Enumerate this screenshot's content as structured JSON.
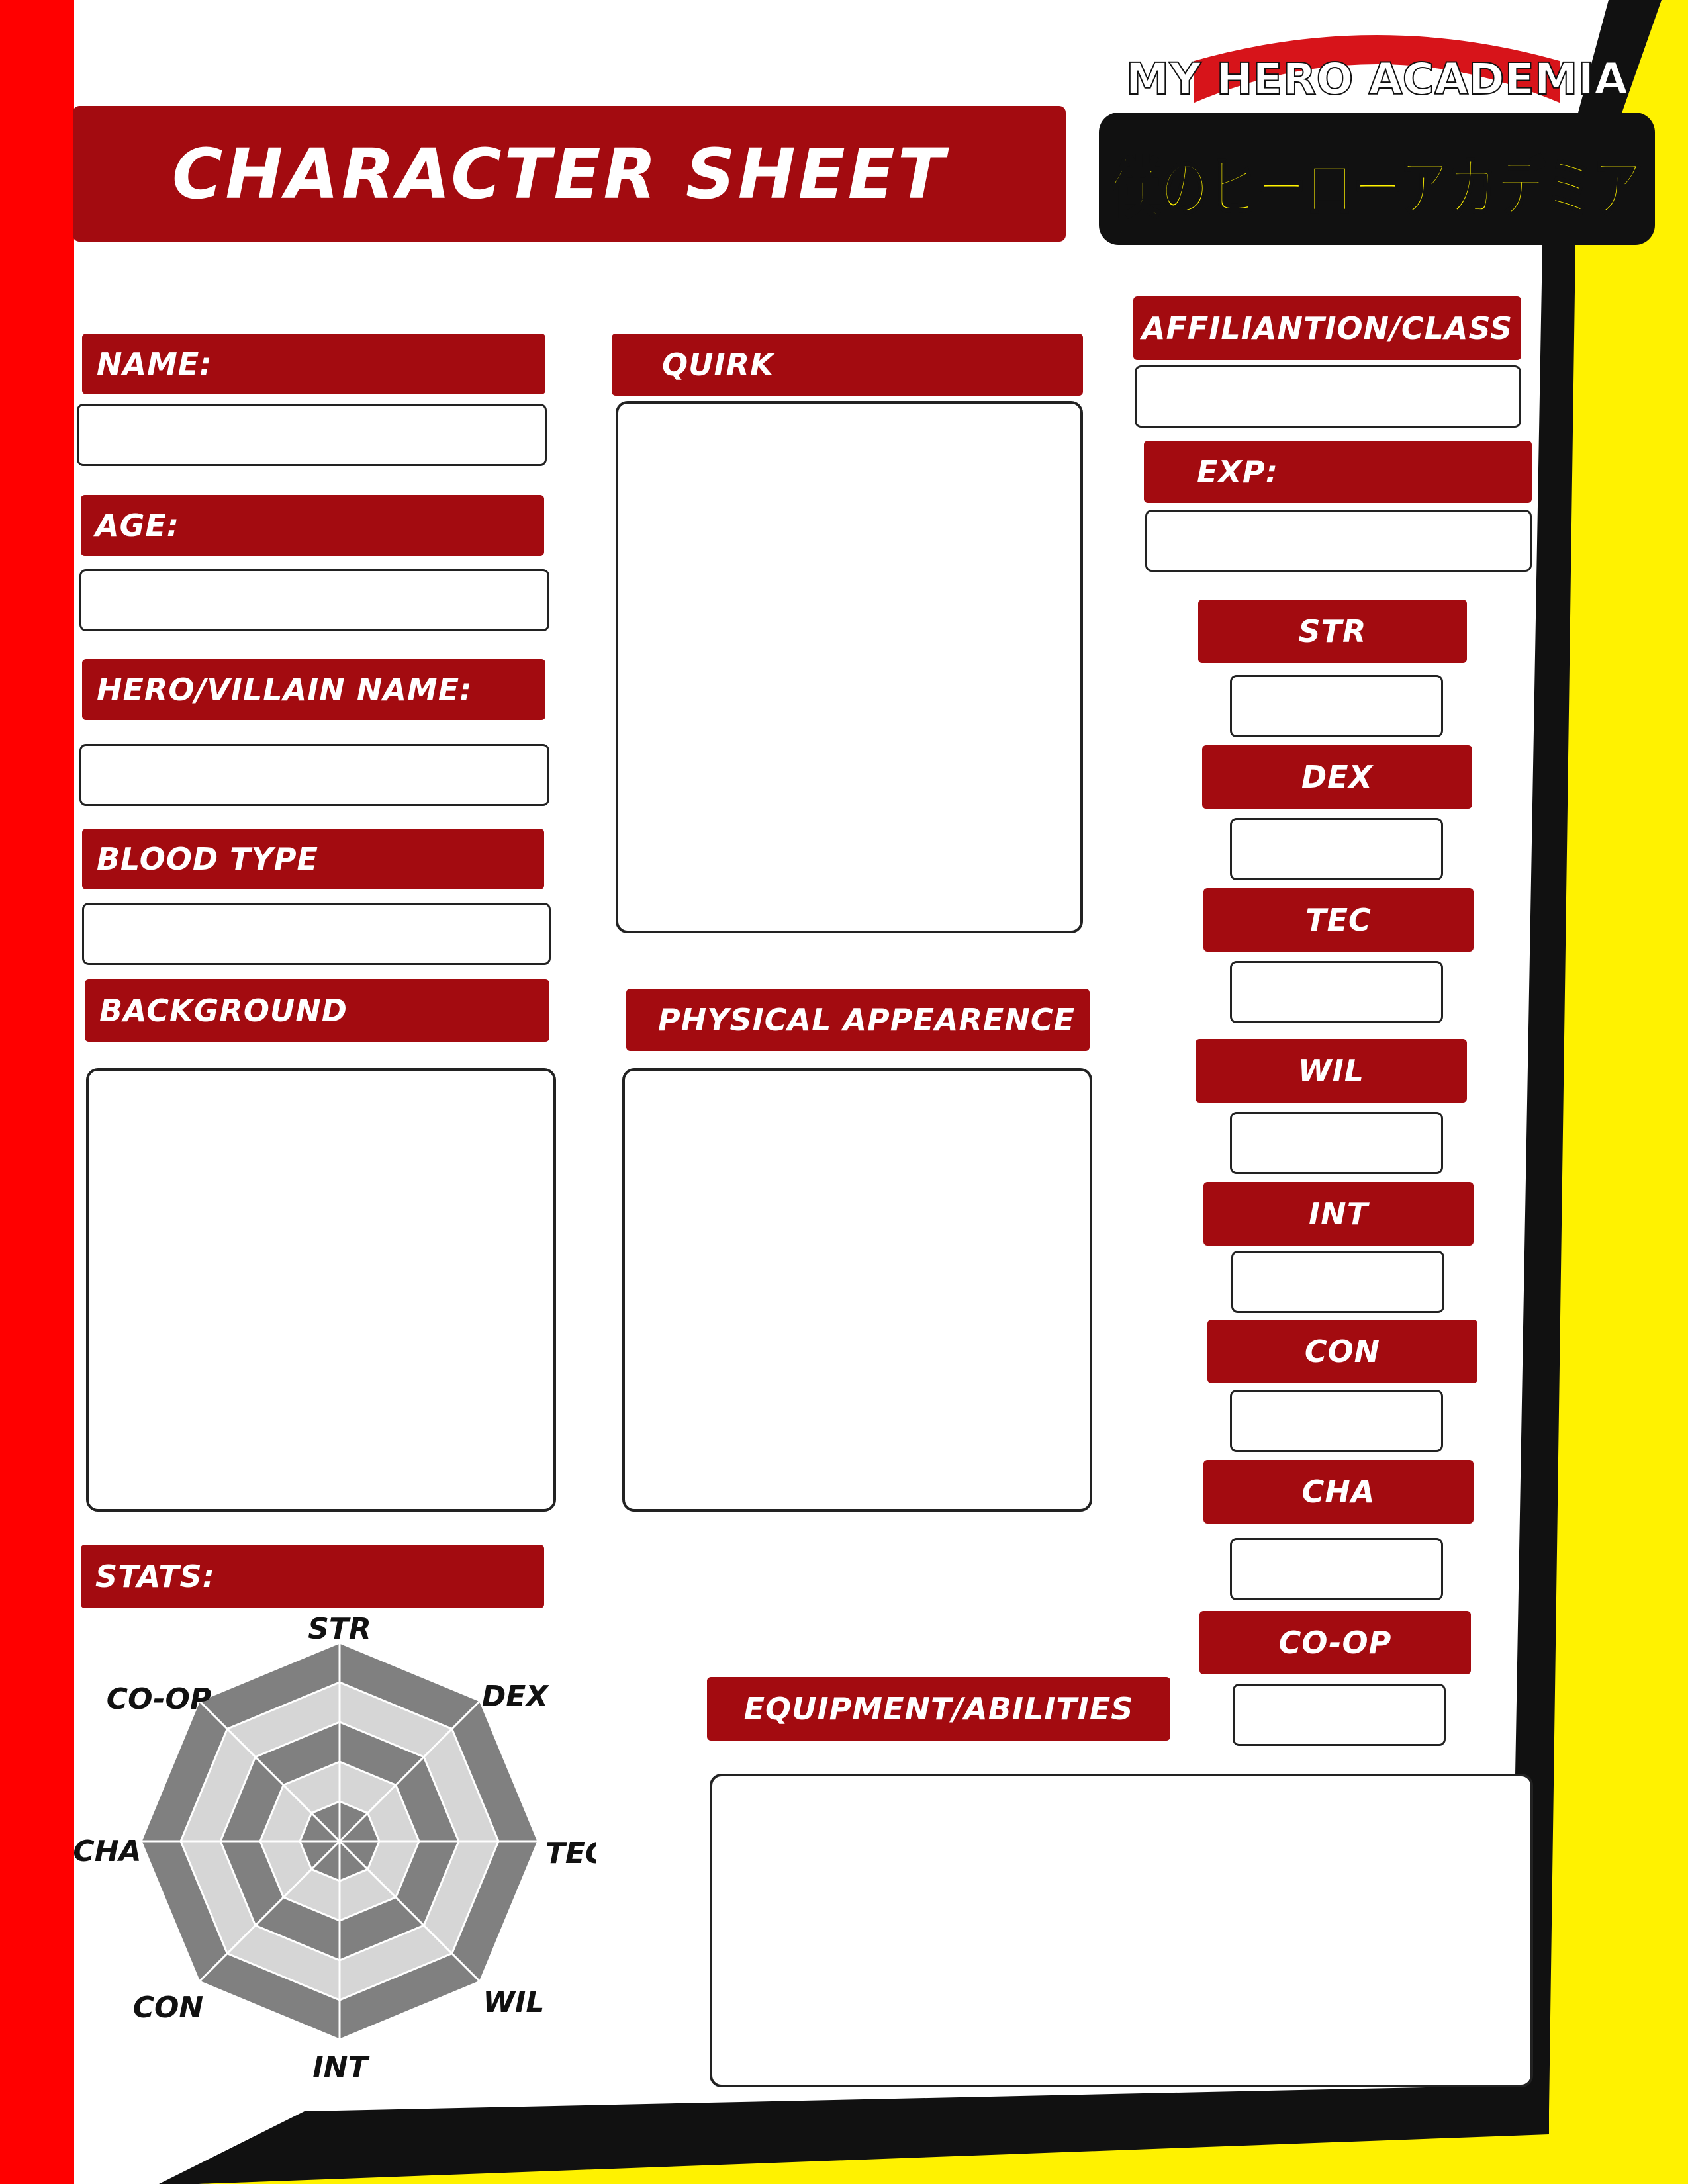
{
  "title": "CHARACTER SHEET",
  "logo": {
    "top_text": "MY HERO ACADEMIA",
    "japanese_text": "僕のヒーローアカデミア"
  },
  "fields": {
    "name": "NAME:",
    "age": "AGE:",
    "hero_villain_name": "HERO/VILLAIN NAME:",
    "blood_type": "BLOOD TYPE",
    "background": "BACKGROUND",
    "stats": "STATS:",
    "quirk": "QUIRK",
    "physical_appearance": "PHYSICAL APPEARENCE",
    "equipment_abilities": "EQUIPMENT/ABILITIES",
    "affiliation_class": "AFFILIANTION/CLASS",
    "exp": "EXP:"
  },
  "stat_boxes": [
    "STR",
    "DEX",
    "TEC",
    "WIL",
    "INT",
    "CON",
    "CHA",
    "CO-OP"
  ],
  "radar": {
    "labels": {
      "str": "STR",
      "dex": "DEX",
      "tec": "TEC",
      "wil": "WIL",
      "int": "INT",
      "con": "CON",
      "cha": "CHA",
      "coop": "CO-OP"
    },
    "rings": 5
  },
  "colors": {
    "banner_red": "#a30b10",
    "side_red": "#ff0000",
    "yellow": "#fff200",
    "logo_red": "#d7141a",
    "radar_dark": "#808080",
    "radar_light": "#d6d6d6"
  }
}
